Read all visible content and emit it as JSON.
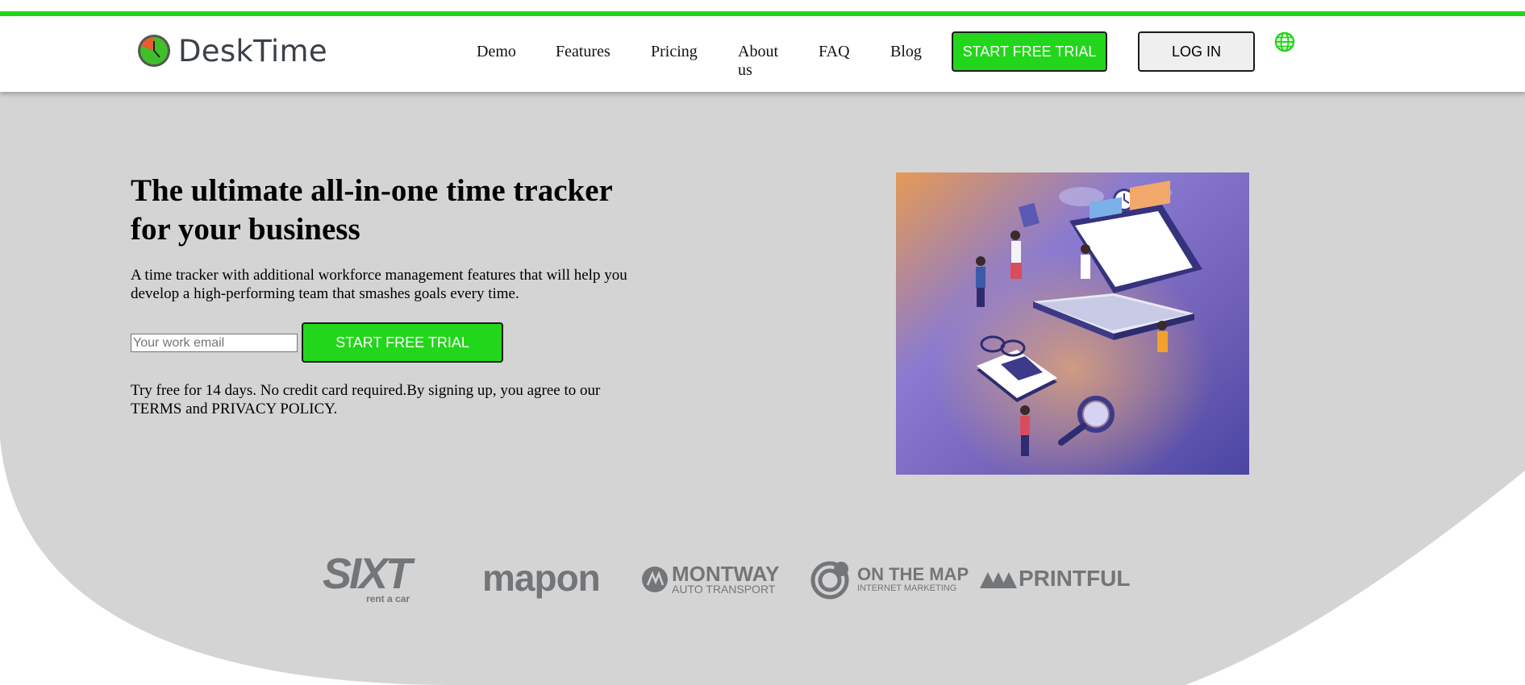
{
  "header": {
    "logo_text": "DeskTime",
    "nav": [
      "Demo",
      "Features",
      "Pricing",
      "About us",
      "FAQ",
      "Blog"
    ],
    "trial_button": "START FREE TRIAL",
    "login_button": "LOG IN"
  },
  "hero": {
    "title": "The ultimate all-in-one time tracker for your business",
    "subtitle": "A time tracker with additional workforce management features that will help you develop a high-performing team that smashes goals every time.",
    "email_placeholder": "Your work email",
    "cta_button": "START FREE TRIAL",
    "note": "Try free for 14 days. No credit card required.By signing up, you agree to our TERMS and PRIVACY POLICY."
  },
  "client_logos": {
    "sixt": {
      "name": "SIXT",
      "tagline": "rent a car"
    },
    "mapon": {
      "name": "mapon"
    },
    "montway": {
      "name": "MONTWAY",
      "tagline": "AUTO TRANSPORT"
    },
    "onthemap": {
      "name": "ON THE MAP",
      "tagline": "INTERNET MARKETING"
    },
    "printful": {
      "name": "PRINTFUL"
    }
  },
  "colors": {
    "accent_green": "#22d61b",
    "hero_background": "#d5d4d5",
    "logo_gray": "#737678"
  }
}
